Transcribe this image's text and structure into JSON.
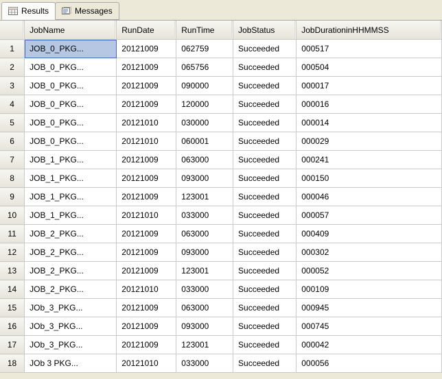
{
  "tabs": {
    "results": "Results",
    "messages": "Messages"
  },
  "columns": {
    "jobName": "JobName",
    "runDate": "RunDate",
    "runTime": "RunTime",
    "jobStatus": "JobStatus",
    "duration": "JobDurationinHHMMSS"
  },
  "chart_data": {
    "type": "table",
    "columns": [
      "JobName",
      "RunDate",
      "RunTime",
      "JobStatus",
      "JobDurationinHHMMSS"
    ],
    "rows": [
      [
        "JOB_0_PKG...",
        "20121009",
        "062759",
        "Succeeded",
        "000517"
      ],
      [
        "JOB_0_PKG...",
        "20121009",
        "065756",
        "Succeeded",
        "000504"
      ],
      [
        "JOB_0_PKG...",
        "20121009",
        "090000",
        "Succeeded",
        "000017"
      ],
      [
        "JOB_0_PKG...",
        "20121009",
        "120000",
        "Succeeded",
        "000016"
      ],
      [
        "JOB_0_PKG...",
        "20121010",
        "030000",
        "Succeeded",
        "000014"
      ],
      [
        "JOB_0_PKG...",
        "20121010",
        "060001",
        "Succeeded",
        "000029"
      ],
      [
        "JOB_1_PKG...",
        "20121009",
        "063000",
        "Succeeded",
        "000241"
      ],
      [
        "JOB_1_PKG...",
        "20121009",
        "093000",
        "Succeeded",
        "000150"
      ],
      [
        "JOB_1_PKG...",
        "20121009",
        "123001",
        "Succeeded",
        "000046"
      ],
      [
        "JOB_1_PKG...",
        "20121010",
        "033000",
        "Succeeded",
        "000057"
      ],
      [
        "JOB_2_PKG...",
        "20121009",
        "063000",
        "Succeeded",
        "000409"
      ],
      [
        "JOB_2_PKG...",
        "20121009",
        "093000",
        "Succeeded",
        "000302"
      ],
      [
        "JOB_2_PKG...",
        "20121009",
        "123001",
        "Succeeded",
        "000052"
      ],
      [
        "JOB_2_PKG...",
        "20121010",
        "033000",
        "Succeeded",
        "000109"
      ],
      [
        "JOb_3_PKG...",
        "20121009",
        "063000",
        "Succeeded",
        "000945"
      ],
      [
        "JOb_3_PKG...",
        "20121009",
        "093000",
        "Succeeded",
        "000745"
      ],
      [
        "JOb_3_PKG...",
        "20121009",
        "123001",
        "Succeeded",
        "000042"
      ],
      [
        "JOb 3 PKG...",
        "20121010",
        "033000",
        "Succeeded",
        "000056"
      ]
    ]
  },
  "selected": {
    "row": 0,
    "col": 0
  }
}
